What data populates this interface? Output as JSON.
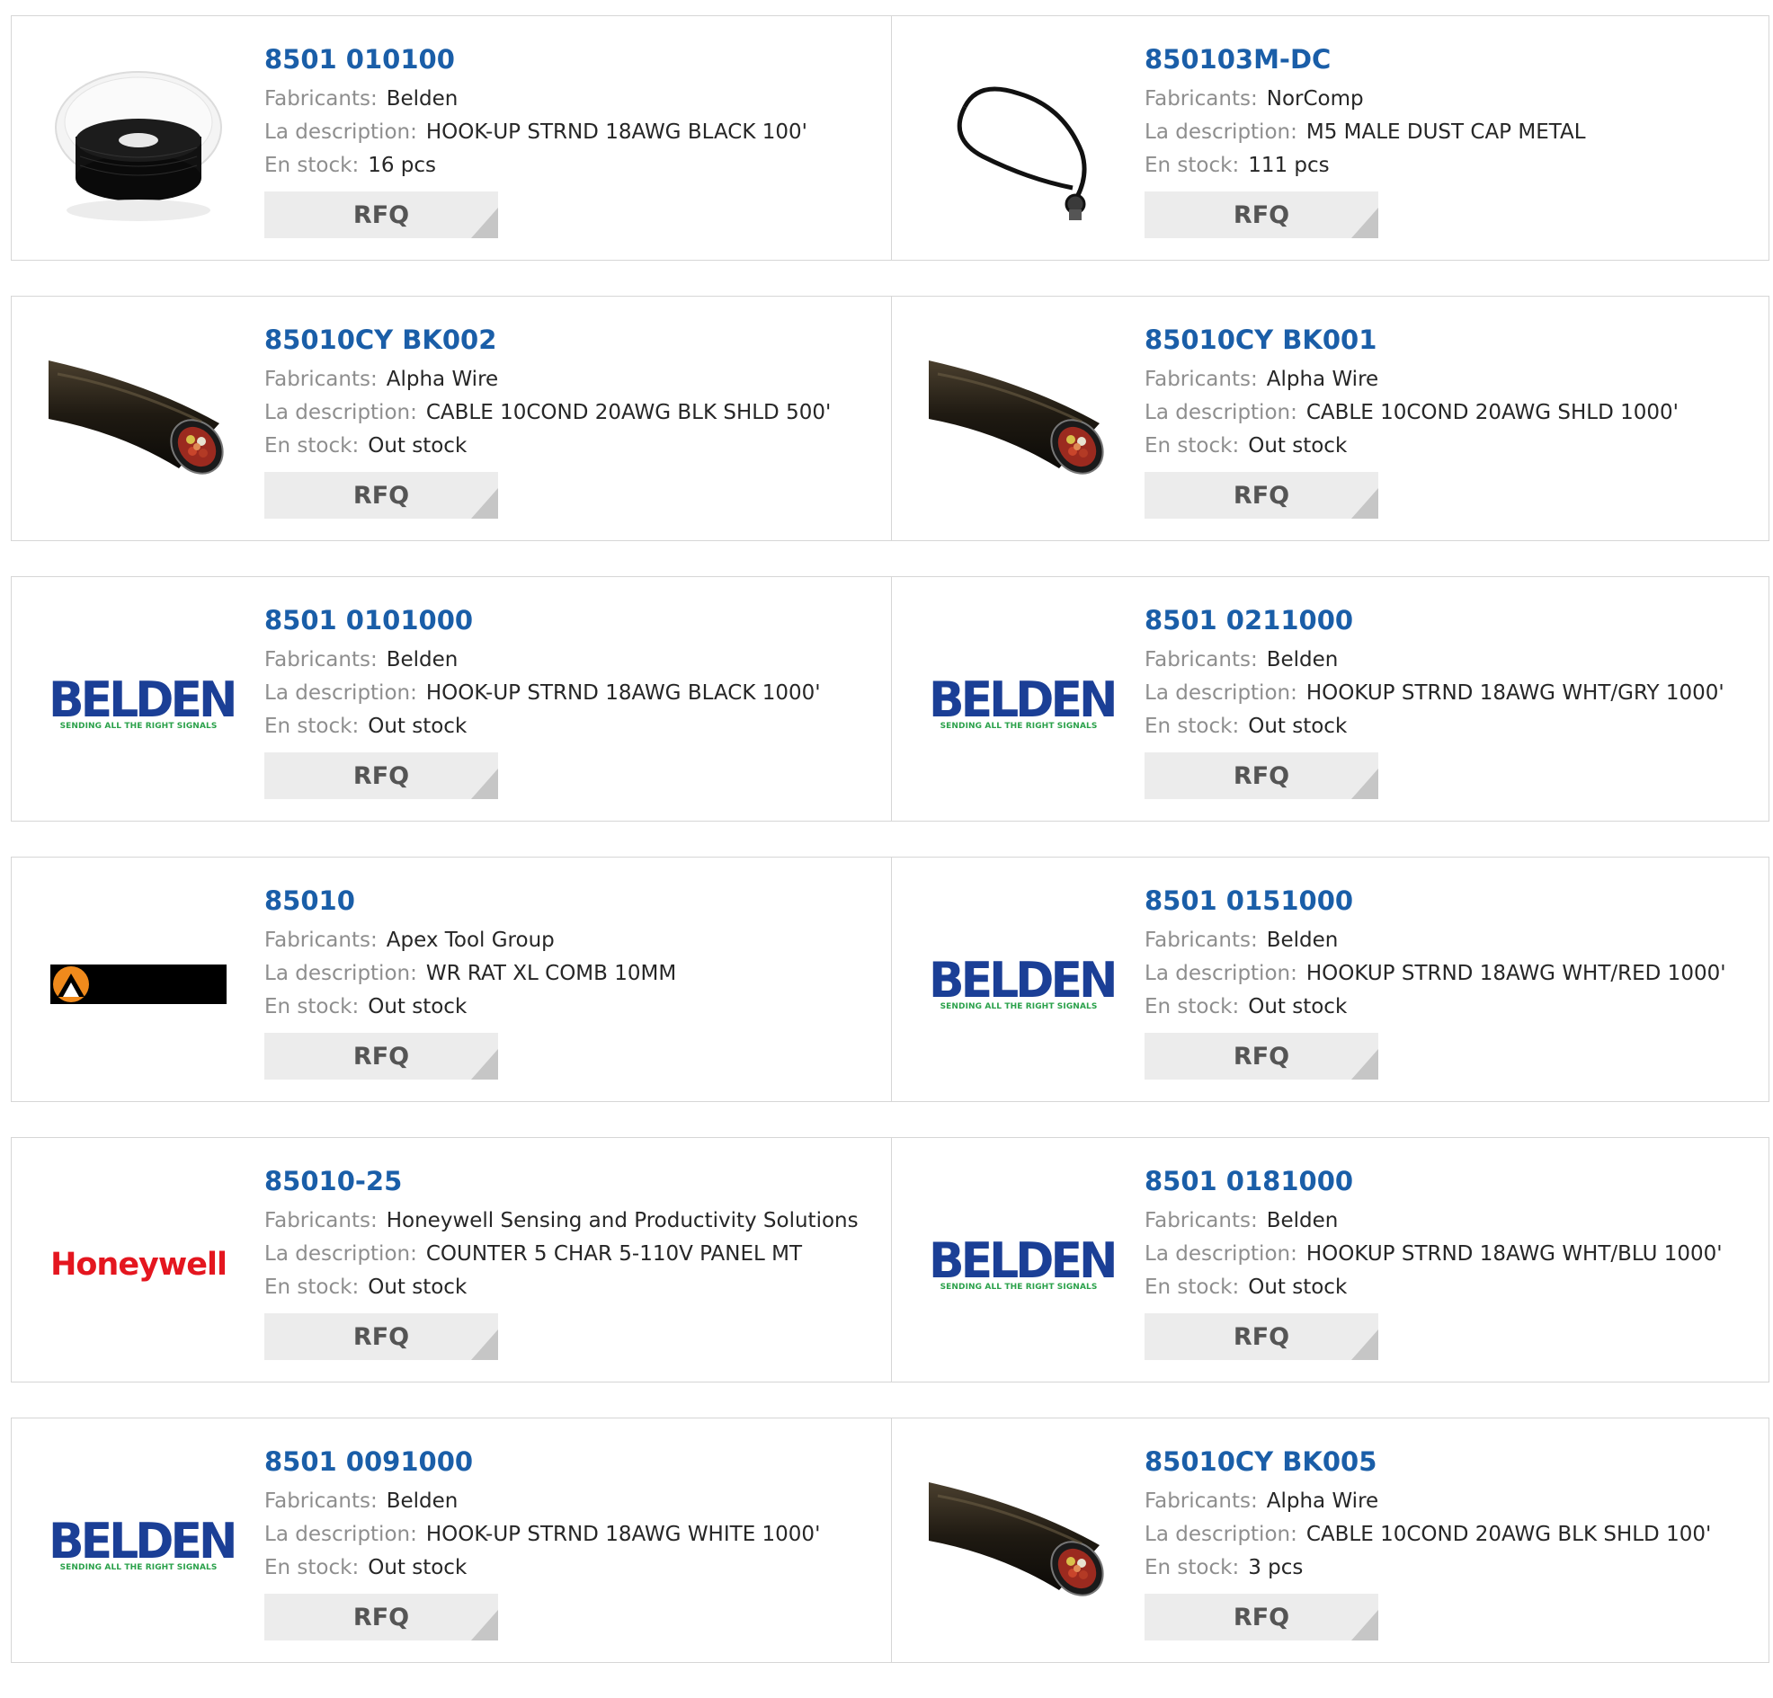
{
  "labels": {
    "manufacturer": "Fabricants:",
    "description": "La description:",
    "stock": "En stock:",
    "rfq": "RFQ"
  },
  "logos": {
    "belden_word": "BELDEN",
    "belden_tagline": "SENDING ALL THE RIGHT SIGNALS",
    "honeywell_word": "Honeywell"
  },
  "colors": {
    "part_link": "#1a5ea8",
    "label": "#8e8e8e",
    "value": "#262626",
    "rfq_bg": "#ececec",
    "belden_blue": "#1b3f96",
    "belden_green": "#2aa14a",
    "honeywell_red": "#e4161f"
  },
  "products": [
    {
      "part": "8501 010100",
      "manufacturer": "Belden",
      "description": "HOOK-UP STRND 18AWG BLACK 100'",
      "stock": "16 pcs",
      "image": "wire-spool-image"
    },
    {
      "part": "850103M-DC",
      "manufacturer": "NorComp",
      "description": "M5 MALE DUST CAP METAL",
      "stock": "111 pcs",
      "image": "dust-cap-lanyard-image"
    },
    {
      "part": "85010CY BK002",
      "manufacturer": "Alpha Wire",
      "description": "CABLE 10COND 20AWG BLK SHLD 500'",
      "stock": "Out stock",
      "image": "cable-cross-section-image"
    },
    {
      "part": "85010CY BK001",
      "manufacturer": "Alpha Wire",
      "description": "CABLE 10COND 20AWG SHLD 1000'",
      "stock": "Out stock",
      "image": "cable-cross-section-image"
    },
    {
      "part": "8501 0101000",
      "manufacturer": "Belden",
      "description": "HOOK-UP STRND 18AWG BLACK 1000'",
      "stock": "Out stock",
      "image": "belden-logo"
    },
    {
      "part": "8501 0211000",
      "manufacturer": "Belden",
      "description": "HOOKUP STRND 18AWG WHT/GRY 1000'",
      "stock": "Out stock",
      "image": "belden-logo"
    },
    {
      "part": "85010",
      "manufacturer": "Apex Tool Group",
      "description": "WR RAT XL COMB 10MM",
      "stock": "Out stock",
      "image": "apex-logo"
    },
    {
      "part": "8501 0151000",
      "manufacturer": "Belden",
      "description": "HOOKUP STRND 18AWG WHT/RED 1000'",
      "stock": "Out stock",
      "image": "belden-logo"
    },
    {
      "part": "85010-25",
      "manufacturer": "Honeywell Sensing and Productivity Solutions",
      "description": "COUNTER 5 CHAR 5-110V PANEL MT",
      "stock": "Out stock",
      "image": "honeywell-logo"
    },
    {
      "part": "8501 0181000",
      "manufacturer": "Belden",
      "description": "HOOKUP STRND 18AWG WHT/BLU 1000'",
      "stock": "Out stock",
      "image": "belden-logo"
    },
    {
      "part": "8501 0091000",
      "manufacturer": "Belden",
      "description": "HOOK-UP STRND 18AWG WHITE 1000'",
      "stock": "Out stock",
      "image": "belden-logo"
    },
    {
      "part": "85010CY BK005",
      "manufacturer": "Alpha Wire",
      "description": "CABLE 10COND 20AWG BLK SHLD 100'",
      "stock": "3 pcs",
      "image": "cable-cross-section-image"
    }
  ]
}
